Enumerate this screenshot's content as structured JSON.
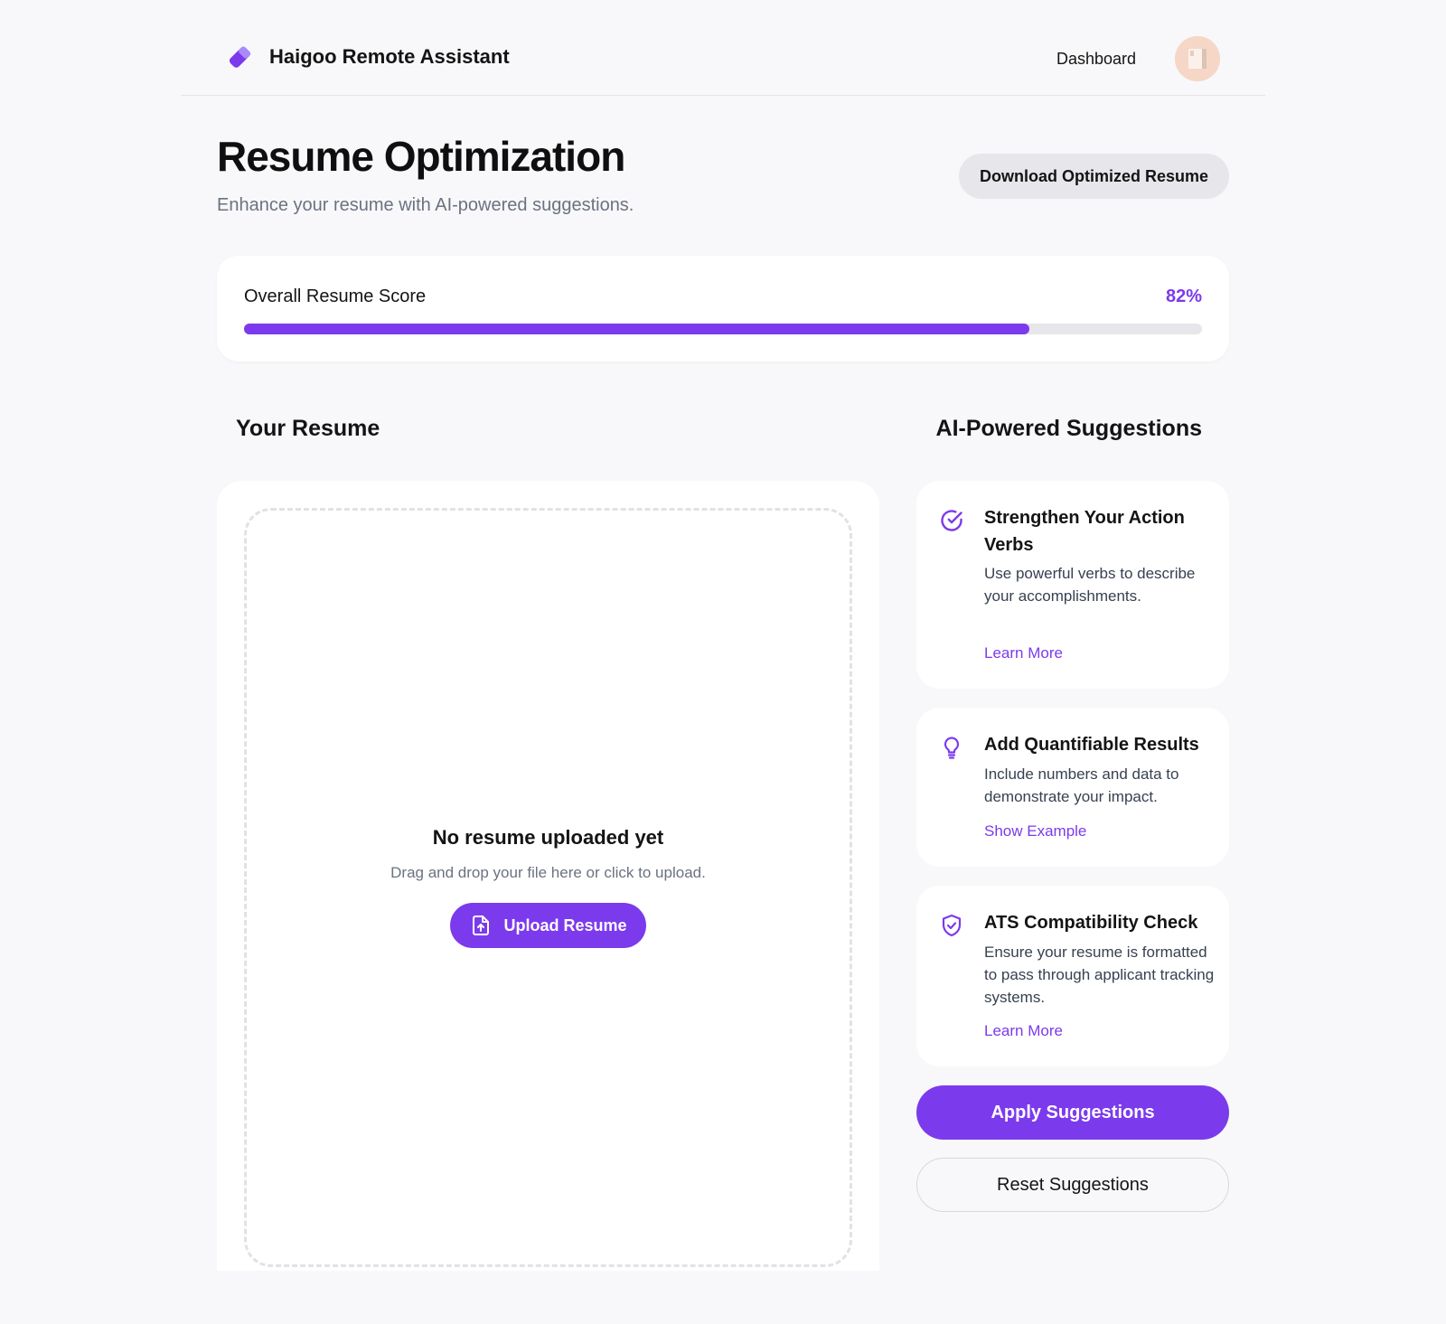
{
  "header": {
    "brand_name": "Haigoo Remote Assistant",
    "brand_icon": "tag-icon",
    "nav_dashboard": "Dashboard",
    "avatar_icon": "user-avatar"
  },
  "page": {
    "title": "Resume Optimization",
    "subtitle": "Enhance your resume with AI-powered suggestions.",
    "download_label": "Download Optimized Resume"
  },
  "score": {
    "label": "Overall Resume Score",
    "value_text": "82%",
    "value_fraction": 0.82
  },
  "resume": {
    "heading": "Your Resume",
    "empty_title": "No resume uploaded yet",
    "empty_subtitle": "Drag and drop your file here or click to upload.",
    "upload_label": "Upload Resume",
    "upload_icon": "file-upload-icon"
  },
  "suggestions": {
    "heading": "AI-Powered Suggestions",
    "items": [
      {
        "icon": "check-circle-icon",
        "title": "Strengthen Your Action Verbs",
        "description": "Use powerful verbs to describe your accomplishments.",
        "link": "Learn More"
      },
      {
        "icon": "lightbulb-icon",
        "title": "Add Quantifiable Results",
        "description": "Include numbers and data to demonstrate your impact.",
        "link": "Show Example"
      },
      {
        "icon": "shield-check-icon",
        "title": "ATS Compatibility Check",
        "description": "Ensure your resume is formatted to pass through applicant tracking systems.",
        "link": "Learn More"
      }
    ],
    "apply_label": "Apply Suggestions",
    "reset_label": "Reset Suggestions"
  },
  "colors": {
    "accent": "#7c3aed",
    "background": "#f8f8fa",
    "card": "#ffffff",
    "muted_text": "#6b7280"
  }
}
